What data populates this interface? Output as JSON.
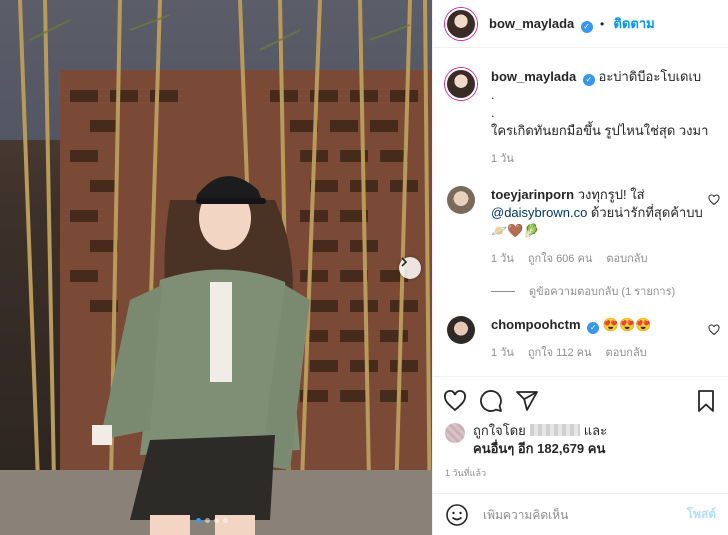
{
  "post": {
    "username": "bow_maylada",
    "follow_label": "ติดตาม",
    "separator": "•",
    "caption": "อะบ่าดิบีอะโบเดเบ\n.\n.\nใครเกิดทันยกมือขึ้น รูปไหนใช่สุด วงมา",
    "caption_time": "1 วัน",
    "photo_dots": 4,
    "active_dot": 0
  },
  "comments": [
    {
      "username": "toeyjarinporn",
      "verified": false,
      "text_before": "วงทุกรูป! ใส่",
      "mention": "@daisybrown.co",
      "text_after": "ด้วยน่ารักที่สุดค้าบบ 🪐🤎🥬",
      "time": "1 วัน",
      "likes": "ถูกใจ 606 คน",
      "reply": "ตอบกลับ",
      "view_replies": "ดูข้อความตอบกลับ (1 รายการ)"
    },
    {
      "username": "chompoohctm",
      "verified": true,
      "text": "😍😍😍",
      "time": "1 วัน",
      "likes": "ถูกใจ 112 คน",
      "reply": "ตอบกลับ"
    }
  ],
  "likes": {
    "prefix": "ถูกใจโดย",
    "and": "และ",
    "others_label": "คนอื่นๆ อีก 182,679 คน"
  },
  "timestamp": "1 วันที่แล้ว",
  "add_comment": {
    "placeholder": "เพิ่มความคิดเห็น",
    "post_label": "โพสต์"
  },
  "icons": {
    "heart": "heart-icon",
    "comment": "comment-icon",
    "share": "share-icon",
    "bookmark": "bookmark-icon",
    "emoji": "emoji-icon",
    "next": "chevron-right-icon"
  },
  "colors": {
    "accent": "#0095f6",
    "verified": "#3897f0",
    "muted": "#8e8e8e"
  }
}
